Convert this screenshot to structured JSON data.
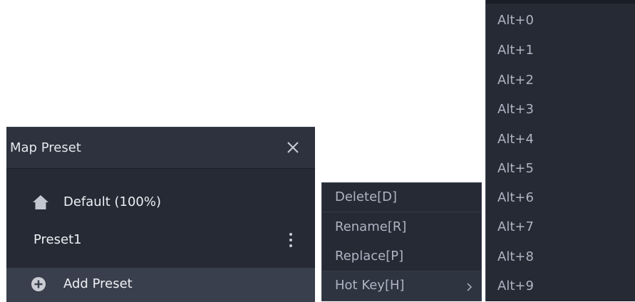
{
  "map_preset_panel": {
    "title": "Map Preset",
    "close_icon": "close-icon",
    "presets": [
      {
        "label": "Default (100%)",
        "icon": "home-icon"
      },
      {
        "label": "Preset1",
        "icon": "more-vertical-icon"
      }
    ],
    "add_label": "Add Preset",
    "add_icon": "plus-circle-icon"
  },
  "context_menu": {
    "items": [
      {
        "label": "Delete[D]"
      },
      {
        "label": "Rename[R]"
      },
      {
        "label": "Replace[P]"
      },
      {
        "label": "Hot Key[H]",
        "has_submenu": true,
        "icon": "chevron-right-icon"
      }
    ]
  },
  "hotkey_menu": {
    "items": [
      "Alt+0",
      "Alt+1",
      "Alt+2",
      "Alt+3",
      "Alt+4",
      "Alt+5",
      "Alt+6",
      "Alt+7",
      "Alt+8",
      "Alt+9"
    ]
  },
  "colors": {
    "panel_bg": "#252a35",
    "header_bg": "#2d323e",
    "add_row_bg": "#3a3f4d",
    "menu_text": "#aeb4c2",
    "primary_text": "#eef0f3"
  }
}
